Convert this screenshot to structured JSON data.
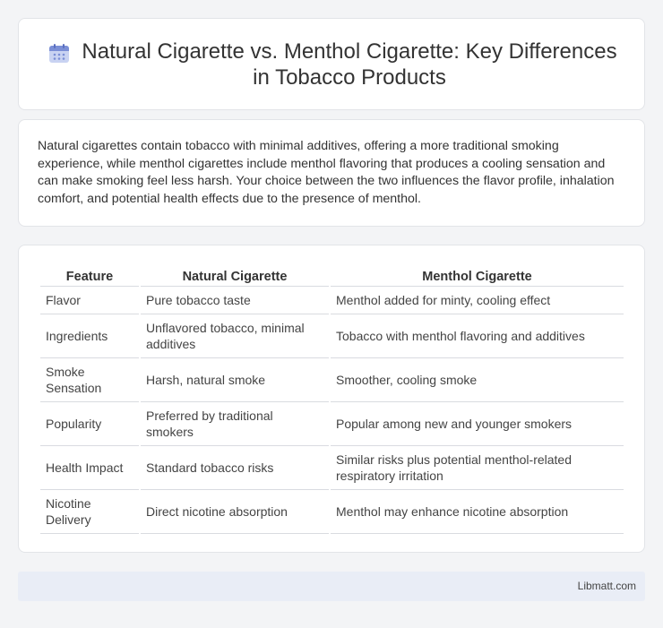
{
  "header": {
    "icon": "calendar-icon",
    "title": "Natural Cigarette vs. Menthol Cigarette: Key Differences in Tobacco Products"
  },
  "intro": {
    "text": "Natural cigarettes contain tobacco with minimal additives, offering a more traditional smoking experience, while menthol cigarettes include menthol flavoring that produces a cooling sensation and can make smoking feel less harsh. Your choice between the two influences the flavor profile, inhalation comfort, and potential health effects due to the presence of menthol."
  },
  "table": {
    "headers": [
      "Feature",
      "Natural Cigarette",
      "Menthol Cigarette"
    ],
    "rows": [
      [
        "Flavor",
        "Pure tobacco taste",
        "Menthol added for minty, cooling effect"
      ],
      [
        "Ingredients",
        "Unflavored tobacco, minimal additives",
        "Tobacco with menthol flavoring and additives"
      ],
      [
        "Smoke Sensation",
        "Harsh, natural smoke",
        "Smoother, cooling smoke"
      ],
      [
        "Popularity",
        "Preferred by traditional smokers",
        "Popular among new and younger smokers"
      ],
      [
        "Health Impact",
        "Standard tobacco risks",
        "Similar risks plus potential menthol-related respiratory irritation"
      ],
      [
        "Nicotine Delivery",
        "Direct nicotine absorption",
        "Menthol may enhance nicotine absorption"
      ]
    ]
  },
  "footer": {
    "text": "Libmatt.com"
  },
  "colors": {
    "background": "#f3f4f6",
    "card": "#ffffff",
    "footer": "#e9edf6",
    "icon_accent": "#7b8fd6"
  }
}
